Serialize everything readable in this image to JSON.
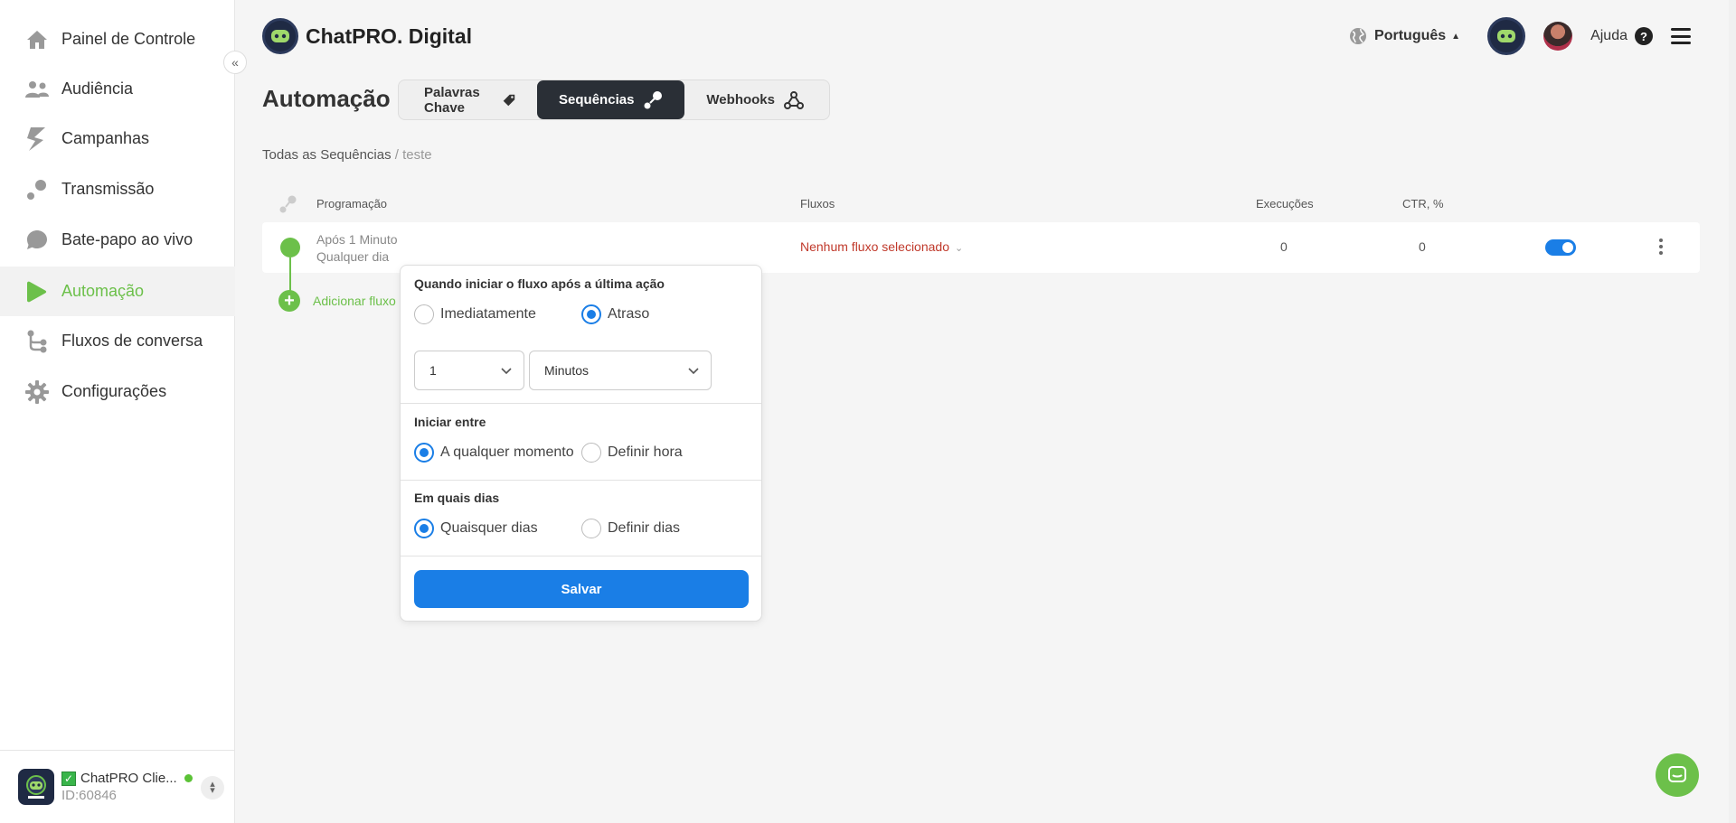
{
  "sidebar": {
    "items": [
      {
        "label": "Painel de Controle",
        "icon": "home-icon"
      },
      {
        "label": "Audiência",
        "icon": "users-icon"
      },
      {
        "label": "Campanhas",
        "icon": "bolt-icon"
      },
      {
        "label": "Transmissão",
        "icon": "broadcast-icon"
      },
      {
        "label": "Bate-papo ao vivo",
        "icon": "chat-bubble-icon"
      },
      {
        "label": "Automação",
        "icon": "play-icon",
        "active": true
      },
      {
        "label": "Fluxos de conversa",
        "icon": "flow-icon"
      },
      {
        "label": "Configurações",
        "icon": "gear-icon"
      }
    ],
    "account": {
      "name": "ChatPRO Clie...",
      "id": "ID:60846"
    }
  },
  "header": {
    "brand": "ChatPRO. Digital",
    "language": "Português",
    "help": "Ajuda"
  },
  "page": {
    "title": "Automação",
    "tabs": [
      {
        "label": "Palavras Chave",
        "active": false
      },
      {
        "label": "Sequências",
        "active": true
      },
      {
        "label": "Webhooks",
        "active": false
      }
    ],
    "breadcrumb": {
      "root": "Todas as Sequências",
      "separator": "/",
      "current": "teste"
    }
  },
  "table": {
    "headers": {
      "schedule": "Programação",
      "flows": "Fluxos",
      "executions": "Execuções",
      "ctr": "CTR, %"
    },
    "row": {
      "schedule_line1": "Após 1 Minuto",
      "schedule_line2": "Qualquer dia",
      "flow": "Nenhum fluxo selecionado",
      "executions": "0",
      "ctr": "0",
      "enabled": true
    },
    "add_flow": "Adicionar fluxo"
  },
  "popover": {
    "section1_title": "Quando iniciar o fluxo após a última ação",
    "opt_immediately": "Imediatamente",
    "opt_delay": "Atraso",
    "delay_value": "1",
    "delay_unit": "Minutos",
    "section2_title": "Iniciar entre",
    "opt_any_time": "A qualquer momento",
    "opt_set_time": "Definir hora",
    "section3_title": "Em quais dias",
    "opt_any_days": "Quaisquer dias",
    "opt_set_days": "Definir dias",
    "save": "Salvar"
  },
  "colors": {
    "accent_green": "#6cc04a",
    "primary_blue": "#1a7ee6",
    "error_red": "#c0392b",
    "dark_tab": "#2a2f36"
  }
}
